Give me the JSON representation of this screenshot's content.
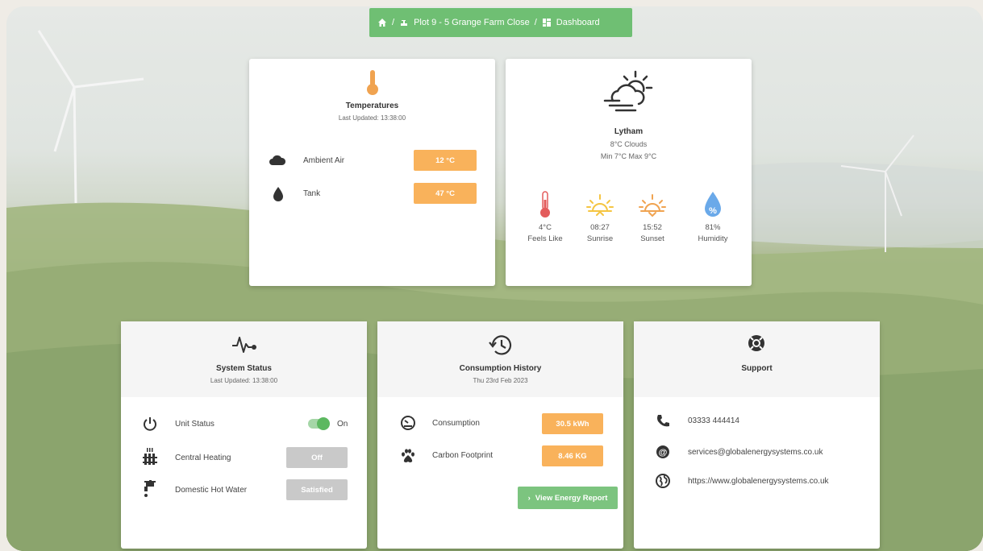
{
  "breadcrumb": {
    "home_icon": "home-icon",
    "plot": "Plot 9 - 5 Grange Farm Close",
    "separator": "/",
    "page": "Dashboard"
  },
  "temperatures": {
    "title": "Temperatures",
    "updated": "Last Updated: 13:38:00",
    "rows": [
      {
        "icon": "cloud-icon",
        "label": "Ambient Air",
        "value": "12 °C"
      },
      {
        "icon": "water-drop-icon",
        "label": "Tank",
        "value": "47 °C"
      }
    ]
  },
  "weather": {
    "location": "Lytham",
    "conditions": "8°C Clouds",
    "minmax": "Min 7°C Max 9°C",
    "items": [
      {
        "icon": "thermometer-icon",
        "value": "4°C",
        "label": "Feels Like"
      },
      {
        "icon": "sunrise-icon",
        "value": "08:27",
        "label": "Sunrise"
      },
      {
        "icon": "sunset-icon",
        "value": "15:52",
        "label": "Sunset"
      },
      {
        "icon": "humidity-icon",
        "value": "81%",
        "label": "Humidity"
      }
    ]
  },
  "system_status": {
    "title": "System Status",
    "updated": "Last Updated: 13:38:00",
    "rows": [
      {
        "label": "Unit Status",
        "value": "On"
      },
      {
        "label": "Central Heating",
        "value": "Off"
      },
      {
        "label": "Domestic Hot Water",
        "value": "Satisfied"
      }
    ]
  },
  "consumption": {
    "title": "Consumption History",
    "date": "Thu 23rd Feb 2023",
    "rows": [
      {
        "label": "Consumption",
        "value": "30.5 kWh"
      },
      {
        "label": "Carbon Footprint",
        "value": "8.46 KG"
      }
    ],
    "report_button": "View Energy Report"
  },
  "support": {
    "title": "Support",
    "phone": "03333 444414",
    "email": "services@globalenergysystems.co.uk",
    "website": "https://www.globalenergysystems.co.uk"
  },
  "colors": {
    "accent_green": "#6fbf73",
    "value_orange": "#f9b25b",
    "status_grey": "#c9c9c9",
    "thermo_orange": "#f0a350",
    "thermo_red": "#e35b5b",
    "sun_yellow": "#f5c542",
    "humidity_blue": "#6aa9e9"
  }
}
